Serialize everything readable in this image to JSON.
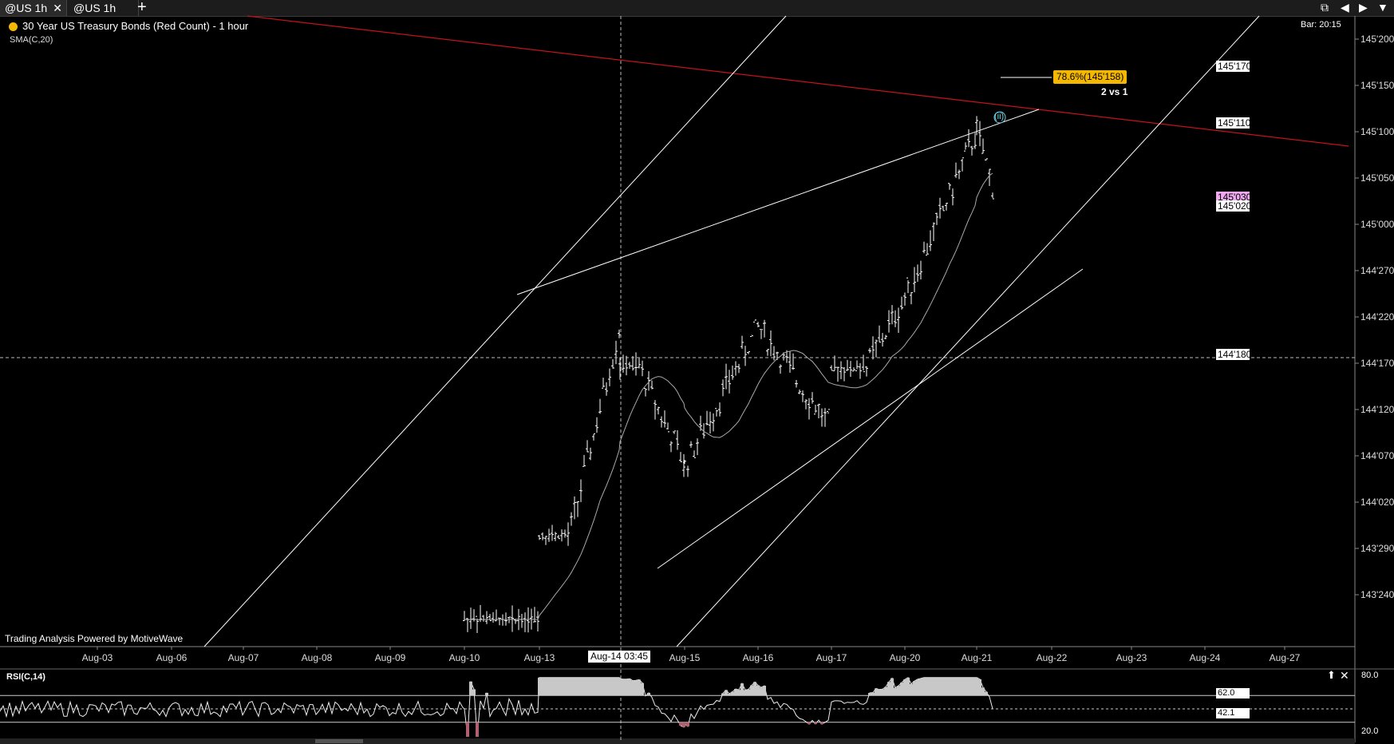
{
  "tabs": [
    {
      "label": "@US 1h",
      "active": true,
      "close_icon": "close-icon"
    },
    {
      "label": "@US 1h",
      "active": false
    }
  ],
  "toolbar": {
    "add_tab_icon": "plus-icon",
    "controls": [
      "window-restore-icon",
      "arrow-left-icon",
      "arrow-right-icon",
      "chevron-down-icon"
    ]
  },
  "chart_header": {
    "title": "30 Year US Treasury Bonds (Red Count) - 1 hour",
    "indicator": "SMA(C,20)",
    "bar_time": "Bar: 20:15",
    "watermark": "Trading Analysis Powered by MotiveWave"
  },
  "annotations": {
    "fib_label": "78.6%(145'158)",
    "wave_compare": "2 vs 1",
    "wave_label": "(ii)",
    "crosshair_date": "Aug-14 03:45"
  },
  "price_tags": [
    {
      "label": "145'170",
      "color": "#ffffff",
      "value": 145.17
    },
    {
      "label": "145'110",
      "color": "#ffffff",
      "value": 145.11
    },
    {
      "label": "145'030",
      "color": "#f0a8f0",
      "value": 145.03
    },
    {
      "label": "145'020",
      "color": "#ffffff",
      "value": 145.02
    },
    {
      "label": "144'180",
      "color": "#ffffff",
      "value": 144.18
    }
  ],
  "rsi_panel": {
    "title": "RSI(C,14)",
    "levels": {
      "upper": 62.0,
      "mid": 50.0,
      "lower": 38.0
    },
    "current_label": "42.1",
    "upper_label": "62.0",
    "ticks": [
      "80.0",
      "62.0",
      "50.0",
      "38.0",
      "20.0"
    ],
    "controls": [
      "arrow-up-icon",
      "close-icon"
    ]
  },
  "colors": {
    "background": "#000000",
    "bars": "#ffffff",
    "sma": "#aaaaaa",
    "red_trendline": "#c0141b",
    "trendlines": "#ffffff",
    "fib_tag": "#f5b800",
    "rsi_fill": "#c8c8c8",
    "rsi_under_fill": "#b06070"
  },
  "chart_data": {
    "type": "bar",
    "title": "30 Year US Treasury Bonds (Red Count) - 1 hour",
    "y_axis_ticks": [
      "145'200",
      "145'150",
      "145'100",
      "145'050",
      "145'000",
      "144'270",
      "144'220",
      "144'170",
      "144'120",
      "144'070",
      "144'020",
      "143'290",
      "143'240"
    ],
    "x_axis_ticks": [
      "Aug-03",
      "Aug-06",
      "Aug-07",
      "Aug-08",
      "Aug-09",
      "Aug-10",
      "Aug-13",
      "Aug-14 03:45",
      "Aug-15",
      "Aug-16",
      "Aug-17",
      "Aug-20",
      "Aug-21",
      "Aug-22",
      "Aug-23",
      "Aug-24",
      "Aug-27"
    ],
    "session_anchor_dates": [
      "Aug-10",
      "Aug-13",
      "Aug-14",
      "Aug-15",
      "Aug-16",
      "Aug-17",
      "Aug-20",
      "Aug-21"
    ],
    "session_closes_approx": [
      143.17,
      144.21,
      144.06,
      144.21,
      144.1,
      144.24,
      145.1,
      145.03
    ],
    "session_highs_approx": [
      143.31,
      144.25,
      144.16,
      145.0,
      144.23,
      145.08,
      145.18,
      145.15
    ],
    "session_lows_approx": [
      143.22,
      143.31,
      143.29,
      143.28,
      144.06,
      144.17,
      144.21,
      145.02
    ],
    "sma_period": 20,
    "rsi_period": 14,
    "grid": false,
    "crosshair": {
      "date": "Aug-14 03:45",
      "price": "144'180"
    }
  }
}
